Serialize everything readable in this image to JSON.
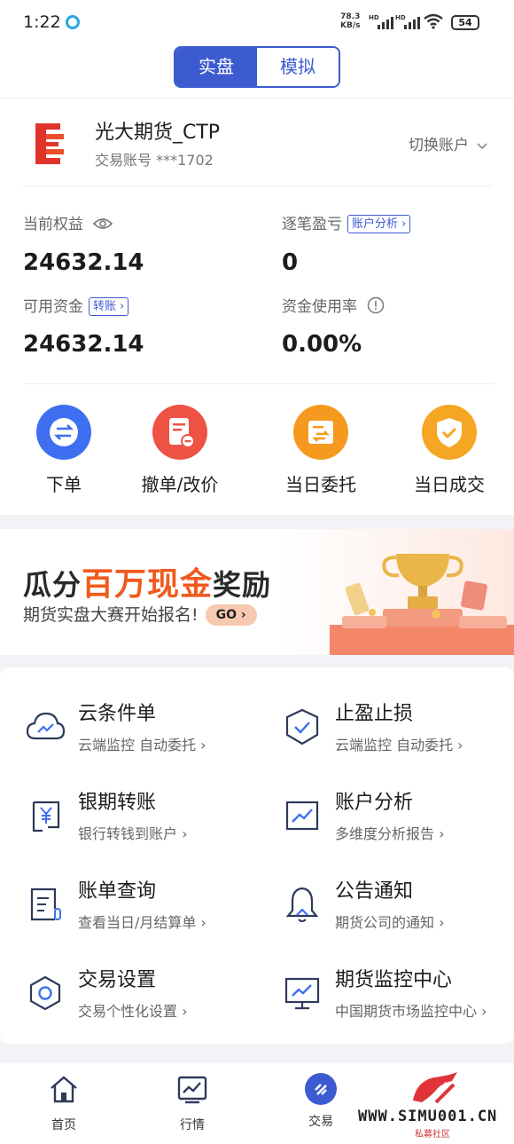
{
  "status_bar": {
    "time": "1:22",
    "net_rate": "78.3",
    "net_unit": "KB/s",
    "signal_1_label": "HD",
    "signal_2_label": "HD",
    "battery": "54"
  },
  "mode_toggle": {
    "active": "实盘",
    "inactive": "模拟"
  },
  "account": {
    "broker_name": "光大期货_CTP",
    "account_label": "交易账号 ***1702",
    "switch_label": "切换账户"
  },
  "metrics": {
    "equity_label": "当前权益",
    "equity_value": "24632.14",
    "pnl_label": "逐笔盈亏",
    "pnl_tag": "账户分析 ›",
    "pnl_value": "0",
    "available_label": "可用资金",
    "available_tag": "转账 ›",
    "available_value": "24632.14",
    "usage_label": "资金使用率",
    "usage_value": "0.00%"
  },
  "quick_actions": [
    {
      "label": "下单",
      "icon": "swap-icon",
      "color": "#3d6ff0"
    },
    {
      "label": "撤单/改价",
      "icon": "cancel-order-icon",
      "color": "#ee5245"
    },
    {
      "label": "当日委托",
      "icon": "entrust-icon",
      "color": "#f59a1e"
    },
    {
      "label": "当日成交",
      "icon": "deal-shield-icon",
      "color": "#f5a623"
    }
  ],
  "banner": {
    "title_pre": "瓜分",
    "title_highlight": "百万现金",
    "title_post": "奖励",
    "subtitle": "期货实盘大赛开始报名!",
    "go_label": "GO ›"
  },
  "services": [
    {
      "title": "云条件单",
      "subtitle": "云端监控 自动委托 ›",
      "icon": "cloud-icon"
    },
    {
      "title": "止盈止损",
      "subtitle": "云端监控 自动委托 ›",
      "icon": "shield-check-icon"
    },
    {
      "title": "银期转账",
      "subtitle": "银行转钱到账户 ›",
      "icon": "yen-transfer-icon"
    },
    {
      "title": "账户分析",
      "subtitle": "多维度分析报告 ›",
      "icon": "chart-line-icon"
    },
    {
      "title": "账单查询",
      "subtitle": "查看当日/月结算单 ›",
      "icon": "bill-icon"
    },
    {
      "title": "公告通知",
      "subtitle": "期货公司的通知 ›",
      "icon": "bell-icon"
    },
    {
      "title": "交易设置",
      "subtitle": "交易个性化设置 ›",
      "icon": "settings-hex-icon"
    },
    {
      "title": "期货监控中心",
      "subtitle": "中国期货市场监控中心 ›",
      "icon": "monitor-icon"
    }
  ],
  "tabbar": [
    {
      "label": "首页",
      "icon": "home-icon"
    },
    {
      "label": "行情",
      "icon": "market-chart-icon"
    },
    {
      "label": "交易",
      "icon": "trade-icon",
      "active": true
    }
  ],
  "watermark": {
    "text": "WWW.SIMU001.CN",
    "sub": "私募社区"
  },
  "colors": {
    "accent": "#3d5bd0",
    "text": "#1c1c1e",
    "subtext": "#666666",
    "banner_highlight": "#f05a1e"
  }
}
